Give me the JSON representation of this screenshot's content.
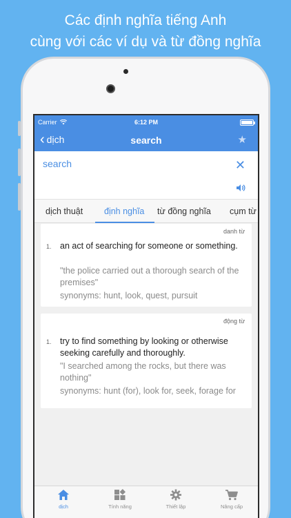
{
  "headline": {
    "line1": "Các định nghĩa tiếng Anh",
    "line2": "cùng với các ví dụ và từ đồng nghĩa"
  },
  "status_bar": {
    "carrier": "Carrier",
    "time": "6:12 PM"
  },
  "nav": {
    "back_label": "dịch",
    "title": "search"
  },
  "input": {
    "query": "search"
  },
  "tabs": [
    "dịch thuật",
    "định nghĩa",
    "từ đồng nghĩa",
    "cụm từ"
  ],
  "active_tab": "định nghĩa",
  "definitions": [
    {
      "part_of_speech": "danh từ",
      "number": "1.",
      "definition": "an act of searching for someone or something.",
      "example": "\"the police carried out a thorough search of the premises\"",
      "synonyms": "synonyms: hunt, look, quest, pursuit"
    },
    {
      "part_of_speech": "động từ",
      "number": "1.",
      "definition": "try to find something by looking or otherwise seeking carefully and thoroughly.",
      "example": "\"I searched among the rocks, but there was nothing\"",
      "synonyms": "synonyms: hunt (for), look for, seek, forage for"
    }
  ],
  "tabbar": [
    {
      "label": "dịch",
      "icon": "home-icon"
    },
    {
      "label": "Tính năng",
      "icon": "features-icon"
    },
    {
      "label": "Thiết lập",
      "icon": "gear-icon"
    },
    {
      "label": "Nâng cấp",
      "icon": "cart-icon"
    }
  ],
  "colors": {
    "background": "#62b3f0",
    "accent": "#4a8ee3",
    "text": "#222222",
    "muted": "#8a8a8a"
  }
}
